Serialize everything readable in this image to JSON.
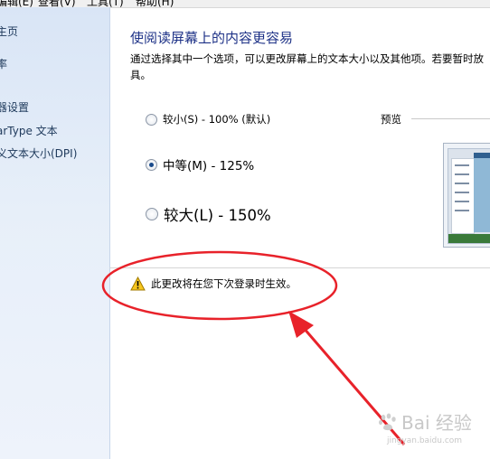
{
  "menubar": {
    "items": [
      "编辑(E)",
      "查看(V)",
      "工具(T)",
      "帮助(H)"
    ]
  },
  "sidebar": {
    "items": [
      {
        "label": "主页"
      },
      {
        "label": "率"
      },
      {
        "label": "器设置"
      },
      {
        "label": "arType 文本"
      },
      {
        "label": "义文本大小(DPI)"
      }
    ]
  },
  "main": {
    "title": "使阅读屏幕上的内容更容易",
    "description_line1": "通过选择其中一个选项，可以更改屏幕上的文本大小以及其他项。若要暂时放",
    "description_line2": "具。",
    "options": [
      {
        "label": "较小(S) - 100% (默认)",
        "checked": false
      },
      {
        "label": "中等(M) - 125%",
        "checked": true
      },
      {
        "label": "较大(L) - 150%",
        "checked": false
      }
    ],
    "preview_label": "预览",
    "warning_text": "此更改将在您下次登录时生效。"
  },
  "annotation": {
    "color": "#e8222a",
    "shape": "ellipse-with-arrow"
  },
  "watermark": {
    "text": "Bai 经验",
    "url": "jingyan.baidu.com"
  },
  "colors": {
    "title": "#1e3287",
    "sidebar_link": "#1e395b",
    "annotation": "#e8222a"
  }
}
